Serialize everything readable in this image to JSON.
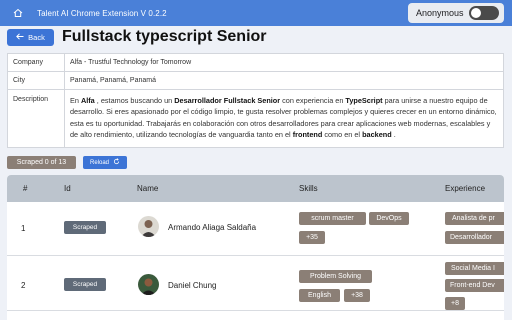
{
  "topbar": {
    "title": "Talent AI Chrome Extension V 0.2.2",
    "home_icon": "home-icon",
    "toggle_label": "Anonymous",
    "toggle_on": false
  },
  "page": {
    "back_label": "Back",
    "title": "Fullstack typescript Senior"
  },
  "info": {
    "company_label": "Company",
    "company_value": "Alfa - Trustful Technology for Tomorrow",
    "city_label": "City",
    "city_value": "Panamá, Panamá, Panamá",
    "description_label": "Description",
    "description_parts": {
      "p1": "En ",
      "b1": "Alfa",
      "p2": " , estamos buscando un ",
      "b2": "Desarrollador Fullstack Senior",
      "p3": "  con experiencia en ",
      "b3": "TypeScript",
      "p4": "  para unirse a nuestro equipo de desarrollo. Si eres apasionado por el código limpio, te gusta resolver problemas complejos y quieres crecer en un entorno dinámico, esta es tu oportunidad. Trabajarás en colaboración con otros desarrolladores para crear aplicaciones web modernas, escalables y de alto rendimiento, utilizando tecnologías de vanguardia tanto en el ",
      "b4": "frontend",
      "p5": "  como en el ",
      "b5": "backend",
      "p6": " ."
    }
  },
  "actions": {
    "scraped_label": "Scraped 0 of 13",
    "reload_label": "Reload"
  },
  "table": {
    "headers": [
      "#",
      "Id",
      "Name",
      "Skills",
      "Experience"
    ],
    "rows": [
      {
        "num": "1",
        "status": "Scraped",
        "name": "Armando Aliaga Saldaña",
        "skills": [
          "scrum master",
          "DevOps",
          "+35"
        ],
        "experience": [
          "Analista de pr",
          "Desarrollador"
        ]
      },
      {
        "num": "2",
        "status": "Scraped",
        "name": "Daniel Chung",
        "skills": [
          "Problem Solving",
          "English",
          "+38"
        ],
        "experience": [
          "Social Media I",
          "Front-end Dev",
          "+8"
        ]
      }
    ]
  }
}
